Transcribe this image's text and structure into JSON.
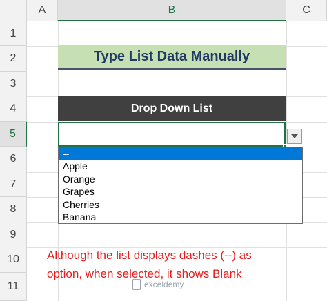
{
  "columns": [
    "A",
    "B",
    "C"
  ],
  "rows": [
    "1",
    "2",
    "3",
    "4",
    "5",
    "6",
    "7",
    "8",
    "9",
    "10",
    "11"
  ],
  "title_cell": "Type List Data Manually",
  "header_cell": "Drop Down List",
  "active_cell_value": "",
  "dropdown": {
    "items": [
      "--",
      "Apple",
      "Orange",
      "Grapes",
      "Cherries",
      "Banana"
    ],
    "highlighted_index": 0
  },
  "note": {
    "line1": "Although the list displays dashes (--) as",
    "line2": "option, when selected, it shows Blank"
  },
  "watermark": "exceldemy",
  "colors": {
    "title_fill": "#c6e0b4",
    "header_fill": "#404040",
    "selection": "#217346",
    "highlight": "#0078d7",
    "note_text": "#e81c1c"
  },
  "icons": [
    "dropdown-arrow-icon",
    "exceldemy-logo-icon"
  ]
}
